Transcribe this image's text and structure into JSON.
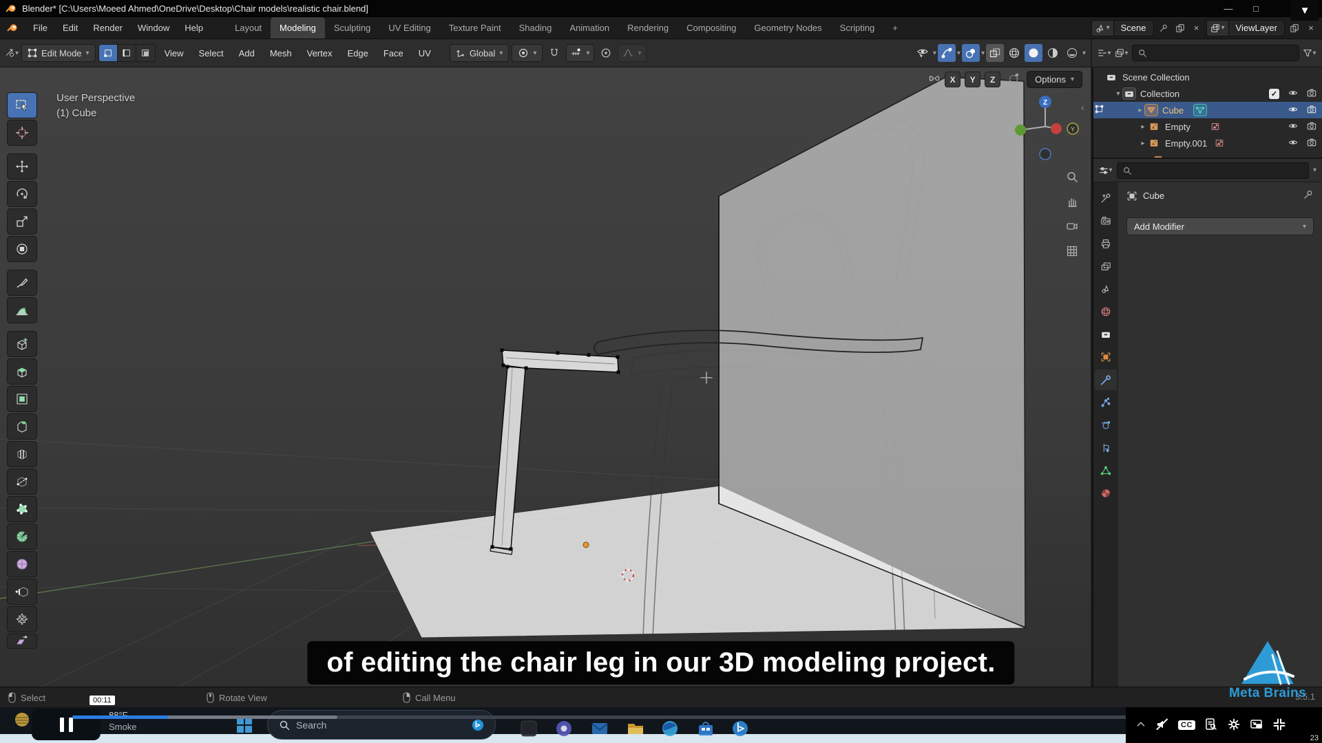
{
  "titlebar": {
    "title": "Blender* [C:\\Users\\Moeed Ahmed\\OneDrive\\Desktop\\Chair models\\realistic chair.blend]"
  },
  "topbar": {
    "menus": [
      "File",
      "Edit",
      "Render",
      "Window",
      "Help"
    ],
    "workspaces": [
      "Layout",
      "Modeling",
      "Sculpting",
      "UV Editing",
      "Texture Paint",
      "Shading",
      "Animation",
      "Rendering",
      "Compositing",
      "Geometry Nodes",
      "Scripting"
    ],
    "active_workspace": "Modeling",
    "add_tab": "+",
    "scene": "Scene",
    "view_layer": "ViewLayer"
  },
  "tool_header": {
    "mode": "Edit Mode",
    "menus": [
      "View",
      "Select",
      "Add",
      "Mesh",
      "Vertex",
      "Edge",
      "Face",
      "UV"
    ],
    "orientation": "Global"
  },
  "viewport": {
    "perspective_label": "User Perspective",
    "object_label": "(1) Cube",
    "axis_x": "X",
    "axis_y": "Y",
    "axis_z": "Z",
    "options_label": "Options",
    "gizmo_z": "Z",
    "gizmo_y": "Y"
  },
  "outliner": {
    "rows": [
      "Scene Collection",
      "Collection",
      "Cube",
      "Empty",
      "Empty.001"
    ]
  },
  "properties": {
    "active_object": "Cube",
    "add_modifier": "Add Modifier"
  },
  "status_bar": {
    "hint_select": "Select",
    "hint_rotate": "Rotate View",
    "hint_menu": "Call Menu",
    "version": "3.5.1"
  },
  "caption": "of editing the chair leg in our 3D modeling project.",
  "player": {
    "time_tooltip": "00:11",
    "cc_label": "CC"
  },
  "taskbar": {
    "weather_temp": "88°F",
    "weather_condition": "Smoke",
    "search_placeholder": "Search",
    "clock_fragment": "23"
  },
  "branding": {
    "name": "Meta Brains"
  },
  "icons": {
    "dropdown": "▾",
    "expander_open": "▾",
    "expander_closed": "▸",
    "minimize": "—",
    "maximize": "□",
    "download": "▼",
    "close": "×",
    "panel_collapse": "‹",
    "check": "✓"
  },
  "colors": {
    "accent_blue": "#4772b3",
    "selection_blue": "#3a5a8c",
    "active_object_text": "#f0c674",
    "progress_blue": "#2a7de1",
    "brand_blue": "#2e9bd6"
  }
}
